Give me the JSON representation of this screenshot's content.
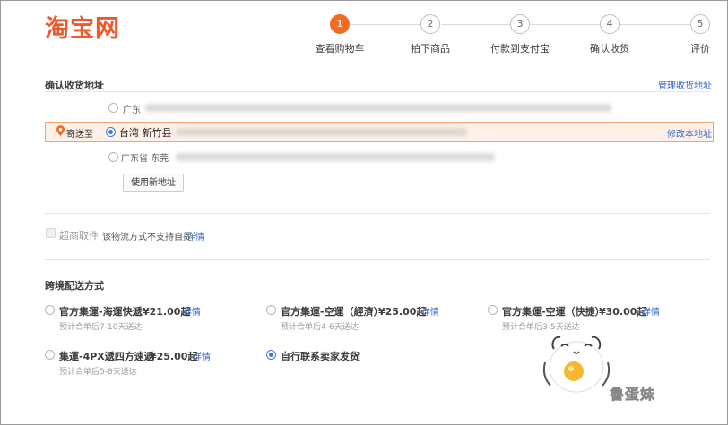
{
  "logo": "淘宝网",
  "steps": [
    {
      "num": "1",
      "label": "查看购物车",
      "active": true
    },
    {
      "num": "2",
      "label": "拍下商品",
      "active": false
    },
    {
      "num": "3",
      "label": "付款到支付宝",
      "active": false
    },
    {
      "num": "4",
      "label": "确认收货",
      "active": false
    },
    {
      "num": "5",
      "label": "评价",
      "active": false
    }
  ],
  "address": {
    "title": "确认收货地址",
    "manage_link": "管理收货地址",
    "send_to": "寄送至",
    "rows": [
      {
        "prefix": "广东",
        "selected": false
      },
      {
        "prefix": "台湾 新竹县",
        "selected": true
      },
      {
        "prefix": "广东省 东莞",
        "selected": false
      }
    ],
    "modify_link": "修改本地址",
    "new_button": "使用新地址"
  },
  "pickup": {
    "label": "超商取件",
    "note": "该物流方式不支持自提",
    "detail": "详情"
  },
  "shipping": {
    "title": "跨境配送方式",
    "options": [
      {
        "name": "官方集運-海運快遞",
        "price": "¥21.00起",
        "detail": "详情",
        "sub": "预计合单后7-10天送达",
        "selected": false
      },
      {
        "name": "官方集運-空運（經濟）",
        "price": "¥25.00起",
        "detail": "详情",
        "sub": "预计合单后4-6天送达",
        "selected": false
      },
      {
        "name": "官方集運-空運（快捷）",
        "price": "¥30.00起",
        "detail": "详情",
        "sub": "预计合单后3-5天送达",
        "selected": false
      },
      {
        "name": "集運-4PX遞四方速遞",
        "price": "¥25.00起",
        "detail": "详情",
        "sub": "预计合单后5-8天送达",
        "selected": false
      },
      {
        "name": "自行联系卖家发货",
        "price": "",
        "detail": "",
        "sub": "",
        "selected": true
      }
    ]
  },
  "watermark": "魯蛋妹",
  "colors": {
    "accent": "#f36b21",
    "link": "#3366cc",
    "logo": "#f2562a",
    "radio": "#3b79d6"
  }
}
